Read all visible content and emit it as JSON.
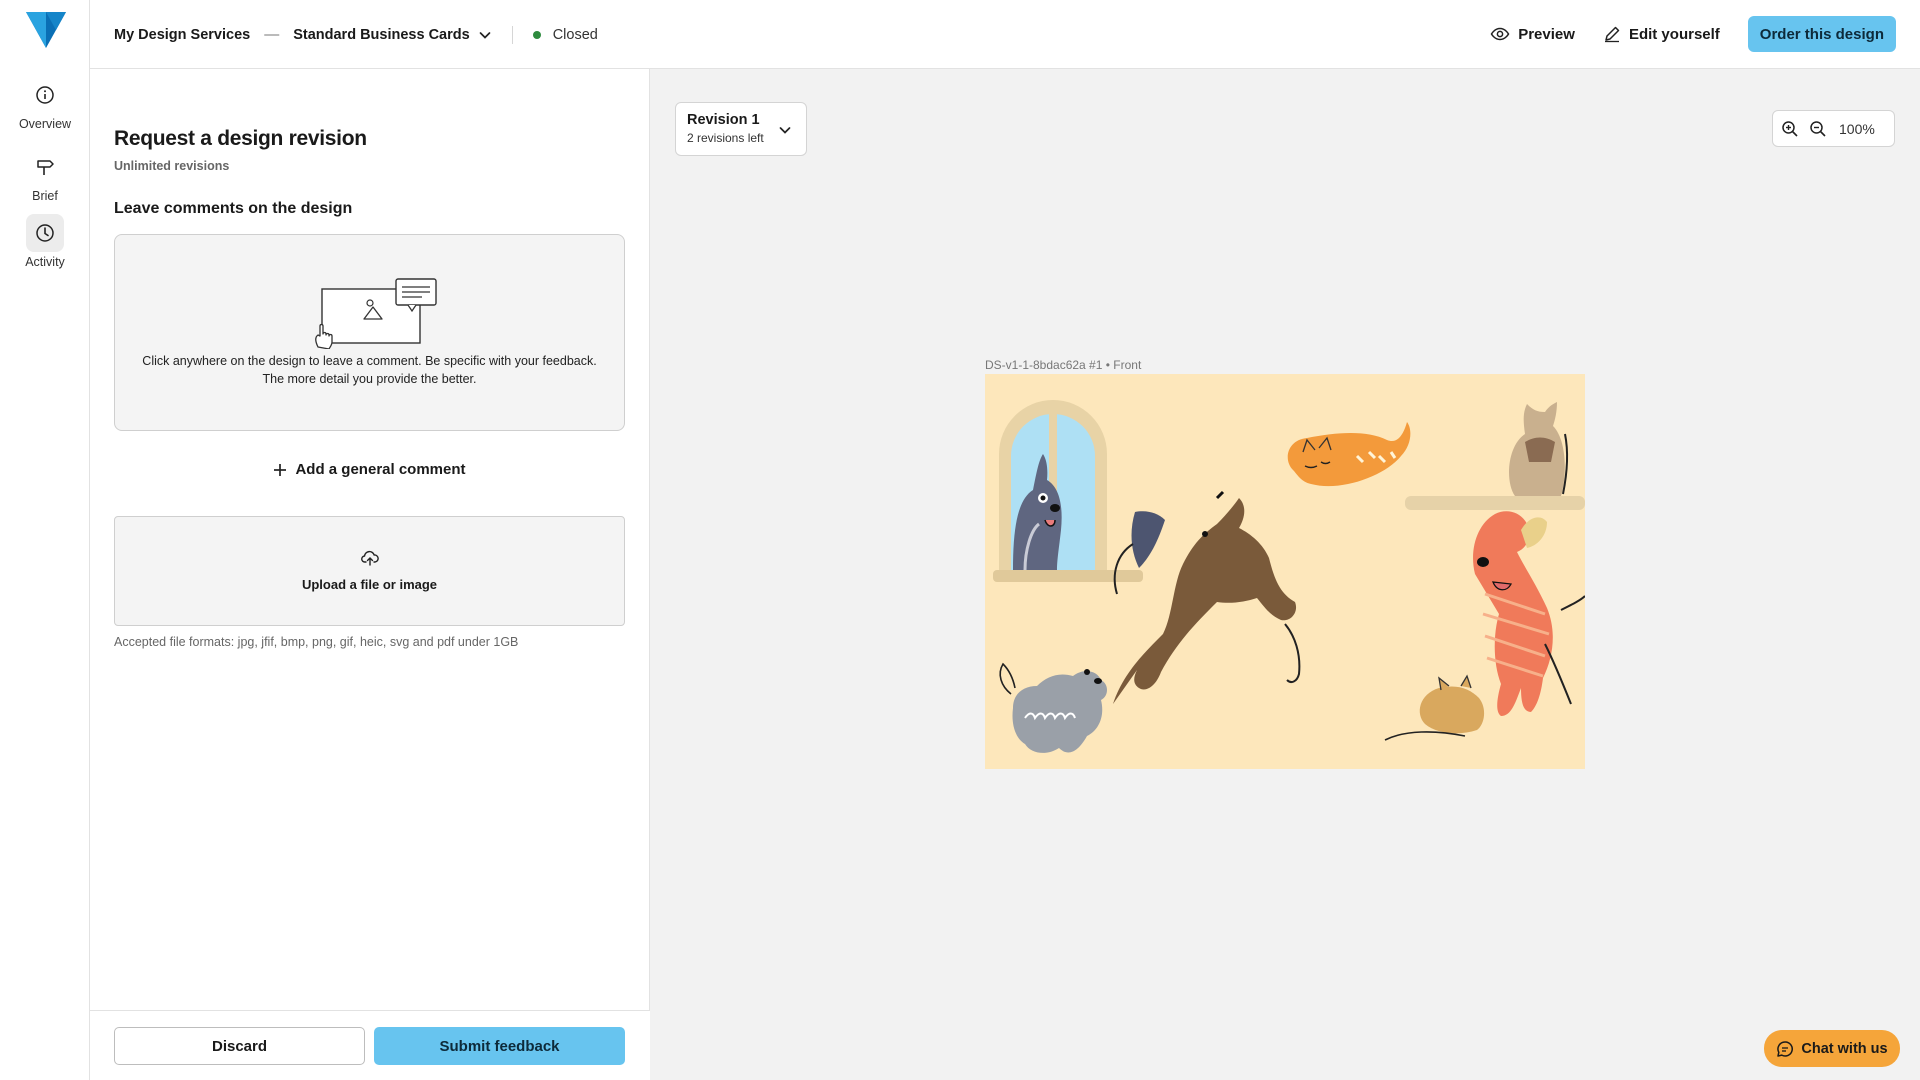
{
  "rail": {
    "items": [
      {
        "label": "Overview",
        "icon": "info-icon"
      },
      {
        "label": "Brief",
        "icon": "signpost-icon"
      },
      {
        "label": "Activity",
        "icon": "clock-icon",
        "active": true
      }
    ]
  },
  "header": {
    "breadcrumb_root": "My Design Services",
    "separator": "—",
    "product": "Standard Business Cards",
    "status": "Closed",
    "status_color": "#2e8b3e",
    "preview_label": "Preview",
    "edit_label": "Edit yourself",
    "order_label": "Order this design",
    "accent_color": "#67c4ef"
  },
  "panel": {
    "title": "Request a design revision",
    "subtitle": "Unlimited revisions",
    "section_heading": "Leave comments on the design",
    "instruction_line1": "Click anywhere on the design to leave a comment. Be specific with your feedback.",
    "instruction_line2": "The more detail you provide the better.",
    "add_comment_label": "Add a general comment",
    "upload_label": "Upload a file or image",
    "formats_note": "Accepted file formats: jpg, jfif, bmp, png, gif, heic, svg and pdf under 1GB",
    "discard_label": "Discard",
    "submit_label": "Submit feedback"
  },
  "canvas": {
    "revision_title": "Revision 1",
    "revision_sub": "2 revisions left",
    "zoom_level": "100%",
    "design_caption": "DS-v1-1-8bdac62a #1 • Front",
    "chat_label": "Chat with us",
    "chat_color": "#f5a53a"
  }
}
